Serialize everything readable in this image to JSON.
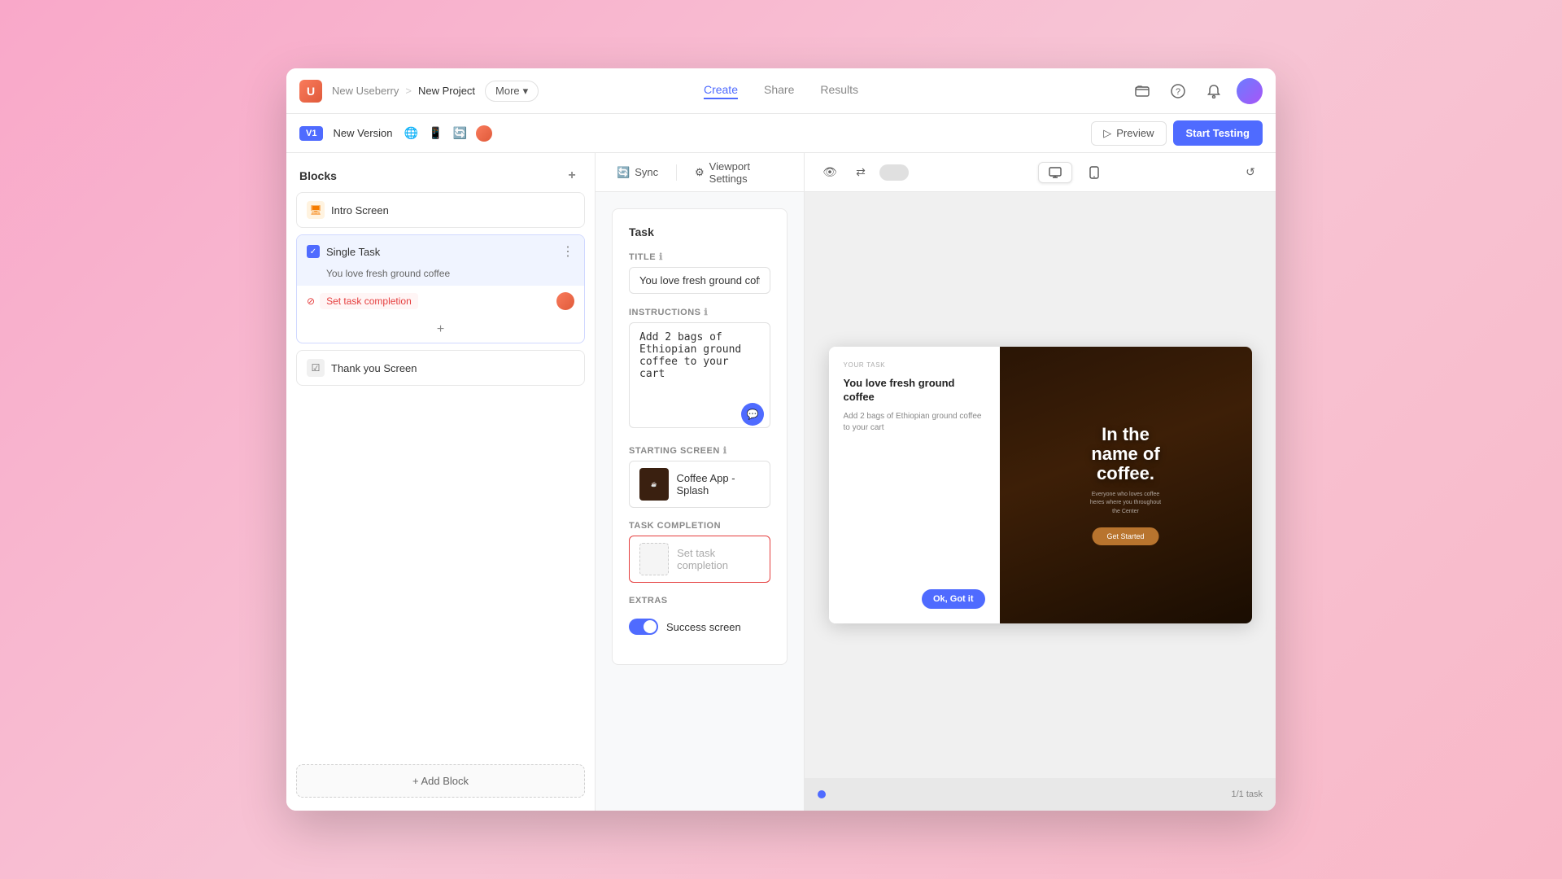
{
  "app": {
    "logo_text": "U",
    "project_parent": "New Useberry",
    "separator": ">",
    "project_name": "New Project",
    "more_label": "More"
  },
  "nav": {
    "tabs": [
      {
        "id": "create",
        "label": "Create",
        "active": true
      },
      {
        "id": "share",
        "label": "Share",
        "active": false
      },
      {
        "id": "results",
        "label": "Results",
        "active": false
      }
    ],
    "preview_label": "Preview",
    "start_testing_label": "Start Testing"
  },
  "sub_nav": {
    "version_badge": "V1",
    "version_label": "New Version"
  },
  "sidebar": {
    "title": "Blocks",
    "blocks": [
      {
        "id": "intro",
        "type": "intro",
        "icon": "🖥",
        "label": "Intro Screen"
      }
    ],
    "single_task": {
      "label": "Single Task",
      "subtitle": "You love fresh ground coffee",
      "completion_warning": "Set task completion",
      "has_avatar": true
    },
    "thank_you": {
      "icon": "☑",
      "label": "Thank you Screen"
    },
    "add_block_label": "+ Add Block"
  },
  "center": {
    "toolbar": {
      "sync_label": "Sync",
      "viewport_label": "Viewport Settings"
    },
    "task": {
      "panel_title": "Task",
      "title_label": "TITLE",
      "title_placeholder": "You love fresh ground coffee",
      "title_value": "You love fresh ground coffee",
      "instructions_label": "INSTRUCTIONS",
      "instructions_value": "Add 2 bags of Ethiopian ground coffee to your cart",
      "starting_screen_label": "STARTING SCREEN",
      "starting_screen_name": "Coffee App - Splash",
      "task_completion_label": "TASK COMPLETION",
      "task_completion_placeholder": "Set task completion",
      "extras_label": "EXTRAS",
      "success_screen_label": "Success screen",
      "success_screen_enabled": true
    }
  },
  "preview": {
    "device_desktop_label": "🖥",
    "device_mobile_label": "📱",
    "task_overlay": {
      "your_task_label": "YOUR TASK",
      "title": "You love fresh ground coffee",
      "description": "Add 2 bags of Ethiopian ground coffee to your cart",
      "ok_button": "Ok, Got it"
    },
    "coffee_app": {
      "headline_line1": "In the",
      "headline_line2": "name of",
      "headline_line3": "coffee.",
      "subtext": "Everyone who loves coffee\nheres where you throughout\nthe Center",
      "cta": "Get Started"
    },
    "bottom_nav": {
      "progress_text": "1/1 task"
    }
  }
}
